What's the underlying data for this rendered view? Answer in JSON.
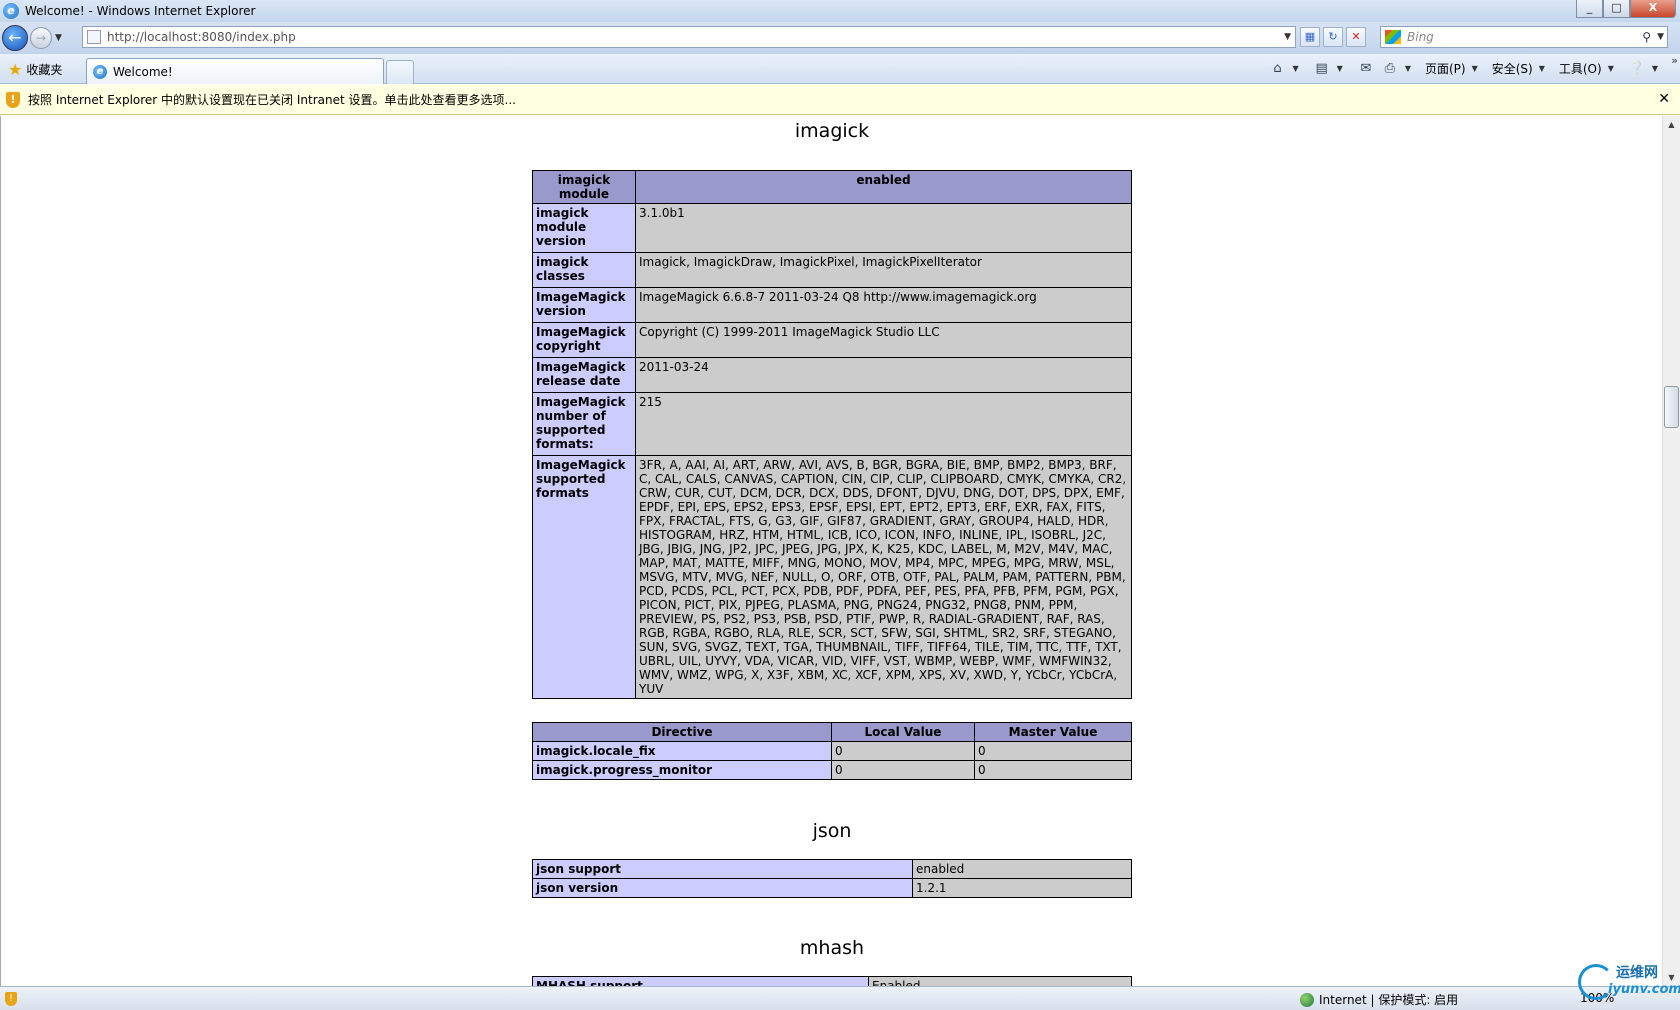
{
  "window": {
    "title": "Welcome! - Windows Internet Explorer",
    "controls": [
      "_",
      "□",
      "X"
    ]
  },
  "address_bar": {
    "url": "http://localhost:8080/index.php",
    "search_placeholder": "Bing"
  },
  "toolbar": {
    "favorites_label": "收藏夹",
    "tab_title": "Welcome!",
    "page_menu": "页面(P)",
    "safety_menu": "安全(S)",
    "tools_menu": "工具(O)"
  },
  "infobar": {
    "message": "按照 Internet Explorer 中的默认设置现在已关闭 Intranet 设置。单击此处查看更多选项..."
  },
  "imagick": {
    "heading": "imagick",
    "header_row": {
      "name": "imagick module",
      "value": "enabled"
    },
    "rows": [
      {
        "name": "imagick module version",
        "value": "3.1.0b1"
      },
      {
        "name": "imagick classes",
        "value": "Imagick, ImagickDraw, ImagickPixel, ImagickPixelIterator"
      },
      {
        "name": "ImageMagick version",
        "value": "ImageMagick 6.6.8-7 2011-03-24 Q8 http://www.imagemagick.org"
      },
      {
        "name": "ImageMagick copyright",
        "value": "Copyright (C) 1999-2011 ImageMagick Studio LLC"
      },
      {
        "name": "ImageMagick release date",
        "value": "2011-03-24"
      },
      {
        "name": "ImageMagick number of supported formats:",
        "value": "215"
      },
      {
        "name": "ImageMagick supported formats",
        "value": "3FR, A, AAI, AI, ART, ARW, AVI, AVS, B, BGR, BGRA, BIE, BMP, BMP2, BMP3, BRF, C, CAL, CALS, CANVAS, CAPTION, CIN, CIP, CLIP, CLIPBOARD, CMYK, CMYKA, CR2, CRW, CUR, CUT, DCM, DCR, DCX, DDS, DFONT, DJVU, DNG, DOT, DPS, DPX, EMF, EPDF, EPI, EPS, EPS2, EPS3, EPSF, EPSI, EPT, EPT2, EPT3, ERF, EXR, FAX, FITS, FPX, FRACTAL, FTS, G, G3, GIF, GIF87, GRADIENT, GRAY, GROUP4, HALD, HDR, HISTOGRAM, HRZ, HTM, HTML, ICB, ICO, ICON, INFO, INLINE, IPL, ISOBRL, J2C, JBG, JBIG, JNG, JP2, JPC, JPEG, JPG, JPX, K, K25, KDC, LABEL, M, M2V, M4V, MAC, MAP, MAT, MATTE, MIFF, MNG, MONO, MOV, MP4, MPC, MPEG, MPG, MRW, MSL, MSVG, MTV, MVG, NEF, NULL, O, ORF, OTB, OTF, PAL, PALM, PAM, PATTERN, PBM, PCD, PCDS, PCL, PCT, PCX, PDB, PDF, PDFA, PEF, PES, PFA, PFB, PFM, PGM, PGX, PICON, PICT, PIX, PJPEG, PLASMA, PNG, PNG24, PNG32, PNG8, PNM, PPM, PREVIEW, PS, PS2, PS3, PSB, PSD, PTIF, PWP, R, RADIAL-GRADIENT, RAF, RAS, RGB, RGBA, RGBO, RLA, RLE, SCR, SCT, SFW, SGI, SHTML, SR2, SRF, STEGANO, SUN, SVG, SVGZ, TEXT, TGA, THUMBNAIL, TIFF, TIFF64, TILE, TIM, TTC, TTF, TXT, UBRL, UIL, UYVY, VDA, VICAR, VID, VIFF, VST, WBMP, WEBP, WMF, WMFWIN32, WMV, WMZ, WPG, X, X3F, XBM, XC, XCF, XPM, XPS, XV, XWD, Y, YCbCr, YCbCrA, YUV"
      }
    ],
    "directives_header": {
      "directive": "Directive",
      "local": "Local Value",
      "master": "Master Value"
    },
    "directives": [
      {
        "name": "imagick.locale_fix",
        "local": "0",
        "master": "0"
      },
      {
        "name": "imagick.progress_monitor",
        "local": "0",
        "master": "0"
      }
    ]
  },
  "json": {
    "heading": "json",
    "rows": [
      {
        "name": "json support",
        "value": "enabled"
      },
      {
        "name": "json version",
        "value": "1.2.1"
      }
    ]
  },
  "mhash": {
    "heading": "mhash",
    "rows": [
      {
        "name": "MHASH support",
        "value": "Enabled"
      }
    ]
  },
  "status_bar": {
    "zone": "Internet | 保护模式: 启用",
    "zoom": "100%"
  },
  "watermark": {
    "line1": "运维网",
    "line2": "iyunv.com"
  }
}
